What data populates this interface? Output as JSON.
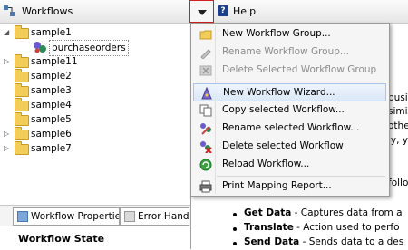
{
  "workflows_panel": {
    "title": "Workflows",
    "tree": [
      {
        "label": "sample1",
        "expanded": true
      },
      {
        "label": "purchaseorders",
        "child": true,
        "selected": true
      },
      {
        "label": "sample11",
        "expanded": false
      },
      {
        "label": "sample2"
      },
      {
        "label": "sample3"
      },
      {
        "label": "sample4"
      },
      {
        "label": "sample5"
      },
      {
        "label": "sample6",
        "expanded": false
      },
      {
        "label": "sample7",
        "expanded": false
      }
    ],
    "tabs": [
      "Workflow Properties",
      "Error Hand"
    ],
    "state_header": "Workflow State"
  },
  "help_panel": {
    "title": "Help",
    "text_lines": [
      "busi",
      "simil",
      "othe",
      "ly, y",
      "follo"
    ],
    "bullets": [
      {
        "term": "Get Data",
        "desc": " - Captures data from a"
      },
      {
        "term": "Translate",
        "desc": " - Action used to perfo"
      },
      {
        "term": "Send Data",
        "desc": " - Sends data to a des"
      }
    ]
  },
  "menu": {
    "items": [
      {
        "label": "New Workflow Group...",
        "icon": "folder-icon",
        "disabled": false
      },
      {
        "label": "Rename Workflow Group...",
        "icon": "rename-icon",
        "disabled": true
      },
      {
        "label": "Delete Selected Workflow Group",
        "icon": "delete-icon",
        "disabled": true
      },
      {
        "label": "New Workflow Wizard...",
        "icon": "wizard-icon",
        "disabled": false,
        "highlighted": true
      },
      {
        "label": "Copy selected Workflow...",
        "icon": "copy-icon",
        "disabled": false
      },
      {
        "label": "Rename selected Workflow...",
        "icon": "rename-workflow-icon",
        "disabled": false
      },
      {
        "label": "Delete selected Workflow",
        "icon": "delete-workflow-icon",
        "disabled": false
      },
      {
        "label": "Reload Workflow...",
        "icon": "reload-icon",
        "disabled": false
      },
      {
        "label": "Print Mapping Report...",
        "icon": "printer-icon",
        "disabled": false
      }
    ]
  },
  "colors": {
    "accent_border": "#d02020",
    "menu_highlight": "#dbe8f8"
  }
}
